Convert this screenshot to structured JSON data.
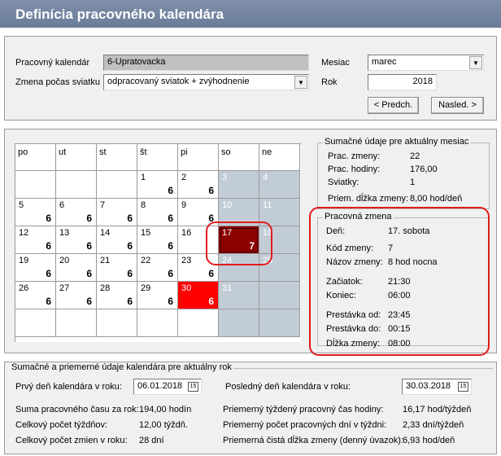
{
  "title": "Definícia pracovného kalendára",
  "form": {
    "calendar_label": "Pracovný kalendár",
    "calendar_value": "6-Upratovacka",
    "holiday_label": "Zmena počas sviatku",
    "holiday_value": "odpracovaný sviatok + zvýhodnenie",
    "month_label": "Mesiac",
    "month_value": "marec",
    "year_label": "Rok",
    "year_value": "2018",
    "prev_button": "< Predch.",
    "next_button": "Nasled. >"
  },
  "calendar": {
    "headers": [
      "po",
      "ut",
      "st",
      "št",
      "pi",
      "so",
      "ne"
    ],
    "weeks": [
      [
        null,
        null,
        null,
        {
          "day": "1",
          "hrs": "6"
        },
        {
          "day": "2",
          "hrs": "6"
        },
        {
          "day": "3",
          "hrs": ""
        },
        {
          "day": "4",
          "hrs": ""
        }
      ],
      [
        {
          "day": "5",
          "hrs": "6"
        },
        {
          "day": "6",
          "hrs": "6"
        },
        {
          "day": "7",
          "hrs": "6"
        },
        {
          "day": "8",
          "hrs": "6"
        },
        {
          "day": "9",
          "hrs": "6"
        },
        {
          "day": "10",
          "hrs": ""
        },
        {
          "day": "11",
          "hrs": ""
        }
      ],
      [
        {
          "day": "12",
          "hrs": "6"
        },
        {
          "day": "13",
          "hrs": "6"
        },
        {
          "day": "14",
          "hrs": "6"
        },
        {
          "day": "15",
          "hrs": "6"
        },
        {
          "day": "16",
          "hrs": ""
        },
        {
          "day": "17",
          "hrs": "7",
          "selected": true
        },
        {
          "day": "18",
          "hrs": ""
        }
      ],
      [
        {
          "day": "19",
          "hrs": "6"
        },
        {
          "day": "20",
          "hrs": "6"
        },
        {
          "day": "21",
          "hrs": "6"
        },
        {
          "day": "22",
          "hrs": "6"
        },
        {
          "day": "23",
          "hrs": "6"
        },
        {
          "day": "24",
          "hrs": ""
        },
        {
          "day": "25",
          "hrs": ""
        }
      ],
      [
        {
          "day": "26",
          "hrs": "6"
        },
        {
          "day": "27",
          "hrs": "6"
        },
        {
          "day": "28",
          "hrs": "6"
        },
        {
          "day": "29",
          "hrs": "6"
        },
        {
          "day": "30",
          "hrs": "6",
          "red": true
        },
        {
          "day": "31",
          "hrs": ""
        },
        null
      ],
      [
        null,
        null,
        null,
        null,
        null,
        null,
        null
      ]
    ]
  },
  "month_summary": {
    "title": "Sumačné údaje pre aktuálny mesiac",
    "rows": [
      {
        "label": "Prac. zmeny:",
        "value": "22"
      },
      {
        "label": "Prac. hodiny:",
        "value": "176,00"
      },
      {
        "label": "Sviatky:",
        "value": "1"
      },
      {
        "label": "Priem. dĺžka zmeny:",
        "value": "8,00 hod/deň"
      }
    ]
  },
  "shift": {
    "title": "Pracovná zmena",
    "rows": [
      {
        "label": "Deň:",
        "value": "17. sobota"
      },
      {
        "label": "Kód zmeny:",
        "value": "7"
      },
      {
        "label": "Názov zmeny:",
        "value": "8 hod nocna"
      },
      {
        "label": "Začiatok:",
        "value": "21:30"
      },
      {
        "label": "Koniec:",
        "value": "06:00"
      },
      {
        "label": "Prestávka od:",
        "value": "23:45"
      },
      {
        "label": "Prestávka do:",
        "value": "00:15"
      },
      {
        "label": "Dĺžka zmeny:",
        "value": "08:00"
      }
    ]
  },
  "year_summary": {
    "title": "Sumačné a priemerné údaje kalendára pre aktuálny rok",
    "first_day_label": "Prvý deň kalendára v roku:",
    "first_day_value": "06.01.2018",
    "last_day_label": "Posledný deň kalendára v roku:",
    "last_day_value": "30.03.2018",
    "date_icon": "15",
    "left": [
      {
        "label": "Suma pracovného času za rok:",
        "value": "194,00 hodín"
      },
      {
        "label": "Celkový počet týždňov:",
        "value": "12,00 týždň."
      },
      {
        "label": "Celkový počet zmien v roku:",
        "value": "28 dní"
      }
    ],
    "right": [
      {
        "label": "Priemerný týždený pracovný čas hodiny:",
        "value": "16,17 hod/týždeň"
      },
      {
        "label": "Priemerný počet pracovných dní v týždni:",
        "value": "2,33 dní/týždeň"
      },
      {
        "label": "Priemerná čistá dĺžka zmeny (denný úvazok):",
        "value": "6,93 hod/deň"
      }
    ]
  }
}
